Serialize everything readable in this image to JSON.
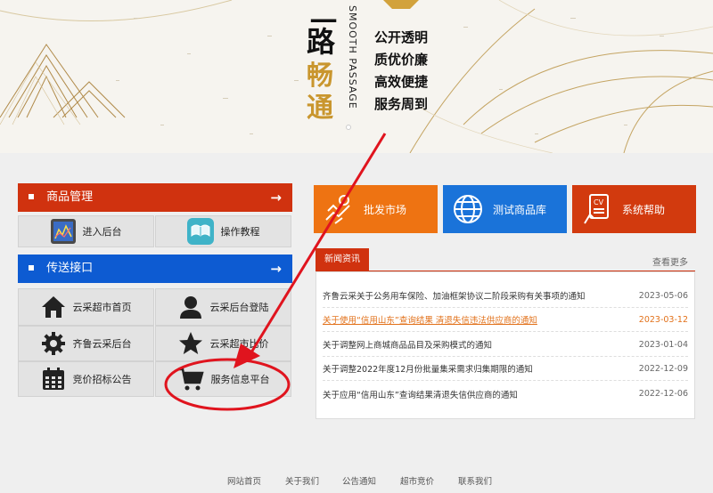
{
  "banner": {
    "slogan_line1": "一",
    "slogan_line2": "路",
    "slogan_gold1": "畅",
    "slogan_gold2": "通",
    "smooth_passage": "SMOOTH PASSAGE",
    "motto": [
      "公开透明",
      "质优价廉",
      "高效便捷",
      "服务周到"
    ]
  },
  "panel_goods": {
    "title": "商品管理",
    "items": [
      {
        "label": "进入后台",
        "icon": "chart-icon"
      },
      {
        "label": "操作教程",
        "icon": "book-icon"
      }
    ]
  },
  "panel_transfer": {
    "title": "传送接口",
    "items": [
      {
        "label": "云采超市首页",
        "icon": "home-icon"
      },
      {
        "label": "云采后台登陆",
        "icon": "user-icon"
      },
      {
        "label": "齐鲁云采后台",
        "icon": "gear-icon"
      },
      {
        "label": "云采超市比价",
        "icon": "star-icon"
      },
      {
        "label": "竞价招标公告",
        "icon": "calendar-icon"
      },
      {
        "label": "服务信息平台",
        "icon": "cart-icon"
      }
    ]
  },
  "tiles": [
    {
      "label": "批发市场",
      "icon": "handshake-icon",
      "color": "#ee7312"
    },
    {
      "label": "测试商品库",
      "icon": "globe-icon",
      "color": "#1a73d9"
    },
    {
      "label": "系统帮助",
      "icon": "cv-icon",
      "color": "#d23a0e"
    }
  ],
  "news": {
    "tab": "新闻资讯",
    "more": "查看更多",
    "items": [
      {
        "title": "齐鲁云采关于公务用车保险、加油框架协议二阶段采购有关事项的通知",
        "date": "2023-05-06"
      },
      {
        "title": "关于使用“信用山东”查询结果 清退失信违法供应商的通知",
        "date": "2023-03-12"
      },
      {
        "title": "关于调整网上商城商品品目及采购模式的通知",
        "date": "2023-01-04"
      },
      {
        "title": "关于调整2022年度12月份批量集采需求归集期限的通知",
        "date": "2022-12-09"
      },
      {
        "title": "关于应用“信用山东”查询结果清退失信供应商的通知",
        "date": "2022-12-06"
      }
    ]
  },
  "footer": [
    "网站首页",
    "关于我们",
    "公告通知",
    "超市竞价",
    "联系我们"
  ],
  "colors": {
    "red": "#d0320f",
    "blue": "#0d5bd2",
    "annotation": "#e0141e"
  }
}
